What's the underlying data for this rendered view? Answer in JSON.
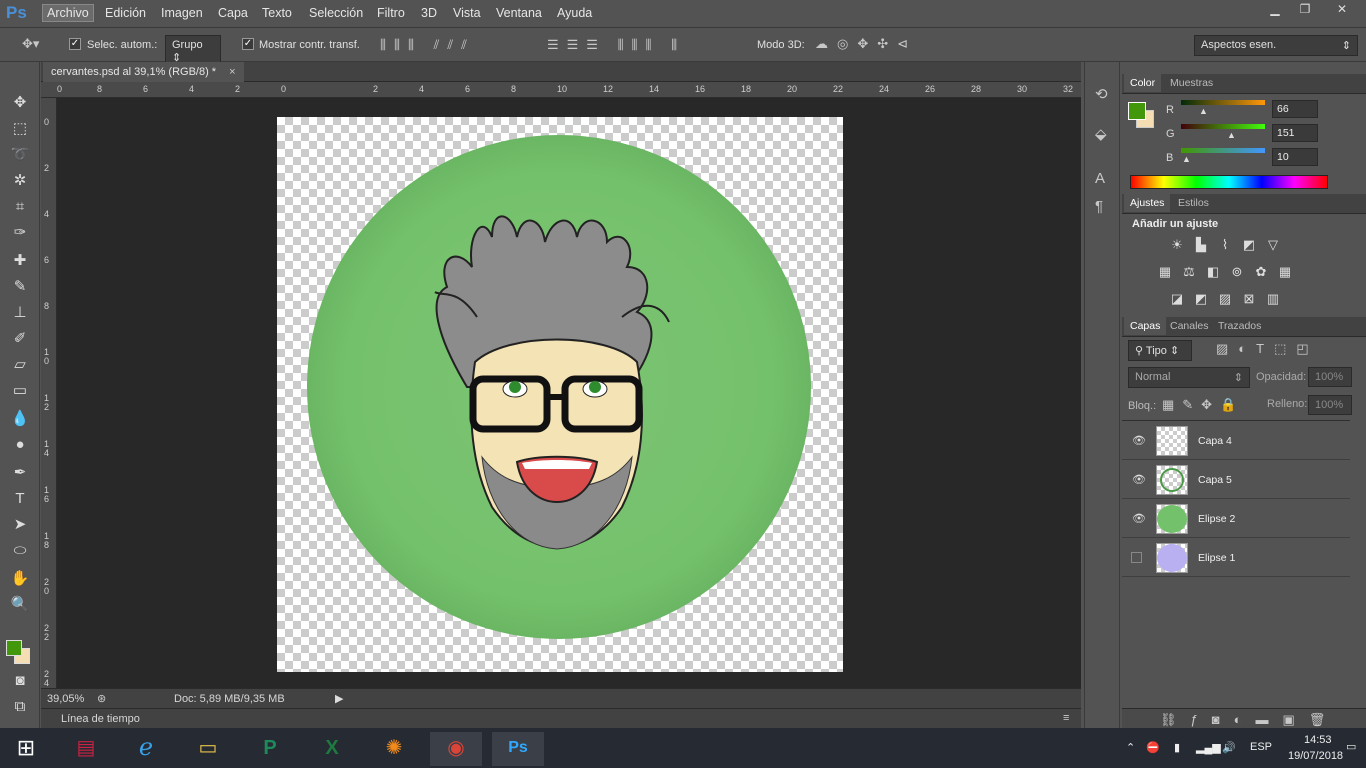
{
  "app": {
    "logo": "Ps",
    "accent": "#4a90d9"
  },
  "menu": [
    "Archivo",
    "Edición",
    "Imagen",
    "Capa",
    "Texto",
    "Selección",
    "Filtro",
    "3D",
    "Vista",
    "Ventana",
    "Ayuda"
  ],
  "window_controls": {
    "minimize": "▁",
    "restore": "❐",
    "close": "✕"
  },
  "options": {
    "auto_select_label": "Selec. autom.:",
    "auto_select_value": "Grupo",
    "show_transform_label": "Mostrar contr. transf.",
    "mode3d_label": "Modo 3D:",
    "workspace_value": "Aspectos esen."
  },
  "document": {
    "tab_title": "cervantes.psd al 39,1% (RGB/8) *",
    "tab_close": "×",
    "zoom": "39,05%",
    "doc_info": "Doc: 5,89 MB/9,35 MB",
    "timeline_label": "Línea de tiempo"
  },
  "ruler_top": [
    "0",
    "8",
    "6",
    "4",
    "2",
    "0",
    "2",
    "4",
    "6",
    "8",
    "10",
    "12",
    "14",
    "16",
    "18",
    "20",
    "22",
    "24",
    "26",
    "28",
    "30",
    "32"
  ],
  "ruler_left": [
    "0",
    "2",
    "4",
    "6",
    "8",
    "1 0",
    "1 2",
    "1 4",
    "1 6",
    "1 8",
    "2 0",
    "2 2",
    "2 4"
  ],
  "color_panel": {
    "tabs": [
      "Color",
      "Muestras"
    ],
    "channels": [
      {
        "name": "R",
        "value": "66"
      },
      {
        "name": "G",
        "value": "151"
      },
      {
        "name": "B",
        "value": "10"
      }
    ],
    "foreground": "#42970a",
    "background": "#f5deb3"
  },
  "adjustments_panel": {
    "tabs": [
      "Ajustes",
      "Estilos"
    ],
    "heading": "Añadir un ajuste"
  },
  "layers_panel": {
    "tabs": [
      "Capas",
      "Canales",
      "Trazados"
    ],
    "filter_label": "Tipo",
    "blend_mode": "Normal",
    "opacity_label": "Opacidad:",
    "opacity_value": "100%",
    "lock_label": "Bloq.:",
    "fill_label": "Relleno:",
    "fill_value": "100%",
    "layers": [
      {
        "name": "Capa 4",
        "visible": true
      },
      {
        "name": "Capa 5",
        "visible": true
      },
      {
        "name": "Elipse 2",
        "visible": true
      },
      {
        "name": "Elipse 1",
        "visible": false
      }
    ]
  },
  "taskbar": {
    "language": "ESP",
    "time": "14:53",
    "date": "19/07/2018",
    "apps": [
      "start",
      "winrar",
      "internet-explorer",
      "file-explorer",
      "publisher",
      "excel",
      "avast",
      "chrome",
      "photoshop"
    ]
  }
}
